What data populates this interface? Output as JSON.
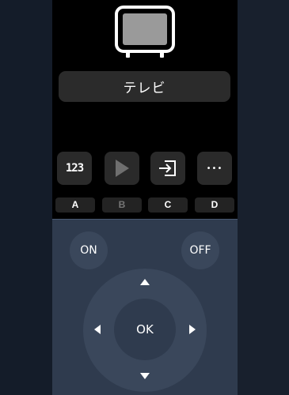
{
  "device": {
    "name": "テレビ"
  },
  "quick_buttons": [
    {
      "icon": "number-pad-icon",
      "glyph": "123",
      "key_label": "A"
    },
    {
      "icon": "play-icon",
      "key_label": "B"
    },
    {
      "icon": "input-switch-icon",
      "key_label": "C"
    },
    {
      "icon": "more-dots-icon",
      "glyph": "•••",
      "key_label": "D"
    }
  ],
  "power": {
    "on_label": "ON",
    "off_label": "OFF"
  },
  "dpad": {
    "ok_label": "OK"
  },
  "colors": {
    "background": "#131b27",
    "top_area": "#000000",
    "remote_area": "#2f3b4e",
    "button": "#3a475b",
    "key_label_active": "#ffffff",
    "key_label_inactive": "#777777"
  }
}
